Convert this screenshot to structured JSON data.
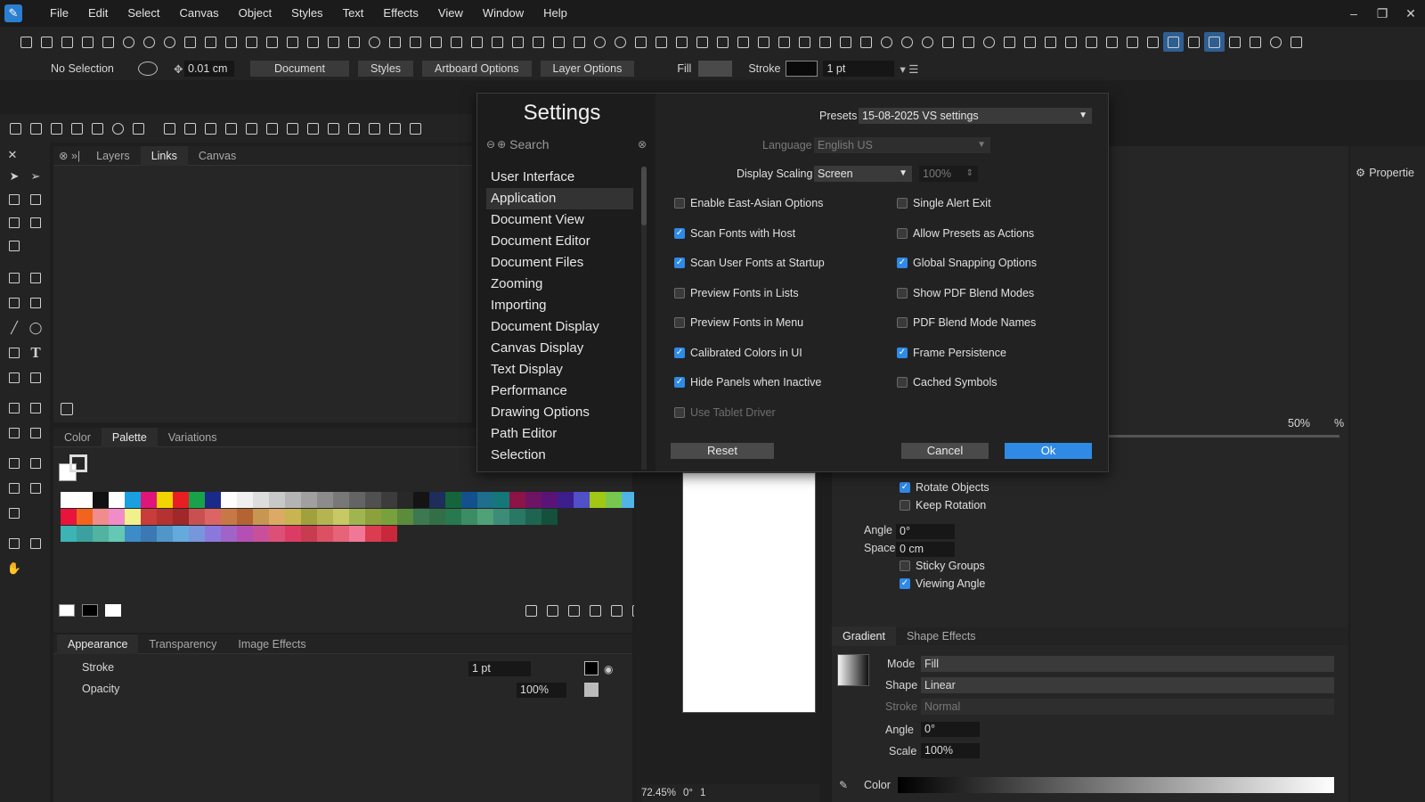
{
  "menubar": {
    "items": [
      "File",
      "Edit",
      "Select",
      "Canvas",
      "Object",
      "Styles",
      "Text",
      "Effects",
      "View",
      "Window",
      "Help"
    ],
    "window_controls": [
      "–",
      "❐",
      "✕"
    ]
  },
  "control_bar": {
    "selection": "No Selection",
    "offset_value": "0.01 cm",
    "buttons": [
      "Document",
      "Styles",
      "Artboard Options",
      "Layer Options"
    ],
    "fill_label": "Fill",
    "stroke_label": "Stroke",
    "stroke_width": "1 pt"
  },
  "links_panel": {
    "tabs": [
      "Layers",
      "Links",
      "Canvas"
    ],
    "active_tab": "Links"
  },
  "palette_panel": {
    "tabs": [
      "Color",
      "Palette",
      "Variations"
    ],
    "active_tab": "Palette"
  },
  "appearance_panel": {
    "tabs": [
      "Appearance",
      "Transparency",
      "Image Effects"
    ],
    "stroke_label": "Stroke",
    "stroke_value": "1 pt",
    "opacity_label": "Opacity",
    "opacity_value": "100%"
  },
  "canvas_status": {
    "zoom": "72.45%",
    "rotation": "0°",
    "page": "1"
  },
  "right_panel": {
    "percent_value": "50%",
    "percent_unit": "%",
    "rotate_objects": "Rotate Objects",
    "keep_rotation": "Keep Rotation",
    "angle_label": "Angle",
    "angle_value": "0°",
    "space_label": "Space",
    "space_value": "0 cm",
    "sticky_groups": "Sticky Groups",
    "viewing_angle": "Viewing Angle",
    "gradient_tabs": [
      "Gradient",
      "Shape Effects"
    ],
    "mode_label": "Mode",
    "mode_value": "Fill",
    "shape_label": "Shape",
    "shape_value": "Linear",
    "stroke_label": "Stroke",
    "stroke_value": "Normal",
    "g_angle_label": "Angle",
    "g_angle_value": "0°",
    "scale_label": "Scale",
    "scale_value": "100%",
    "color_label": "Color"
  },
  "properties_tab": {
    "label": "Propertie"
  },
  "settings": {
    "title": "Settings",
    "search_placeholder": "Search",
    "nav": [
      "User Interface",
      "Application",
      "Document View",
      "Document Editor",
      "Document Files",
      "Zooming",
      "Importing",
      "Document Display",
      "Canvas Display",
      "Text Display",
      "Performance",
      "Drawing Options",
      "Path Editor",
      "Selection"
    ],
    "selected_nav": "Application",
    "presets_label": "Presets",
    "presets_value": "15-08-2025 VS settings",
    "language_label": "Language",
    "language_value": "English US",
    "display_scaling_label": "Display Scaling",
    "display_scaling_value": "Screen",
    "scaling_percent": "100%",
    "options_left": [
      {
        "label": "Enable East-Asian Options",
        "checked": false
      },
      {
        "label": "Scan Fonts with Host",
        "checked": true
      },
      {
        "label": "Scan User Fonts at Startup",
        "checked": true
      },
      {
        "label": "Preview Fonts in Lists",
        "checked": false
      },
      {
        "label": "Preview Fonts in Menu",
        "checked": false
      },
      {
        "label": "Calibrated Colors in UI",
        "checked": true
      },
      {
        "label": "Hide Panels when Inactive",
        "checked": true
      },
      {
        "label": "Use Tablet Driver",
        "checked": false
      }
    ],
    "options_right": [
      {
        "label": "Single Alert Exit",
        "checked": false
      },
      {
        "label": "Allow Presets as Actions",
        "checked": false
      },
      {
        "label": "Global Snapping Options",
        "checked": true
      },
      {
        "label": "Show PDF Blend Modes",
        "checked": false
      },
      {
        "label": "PDF Blend Mode Names",
        "checked": false
      },
      {
        "label": "Frame Persistence",
        "checked": true
      },
      {
        "label": "Cached Symbols",
        "checked": false
      }
    ],
    "reset_label": "Reset",
    "cancel_label": "Cancel",
    "ok_label": "Ok"
  },
  "colors": {
    "accent": "#2f8ae6",
    "dialog_bg": "#222222",
    "panel_bg": "#262626"
  }
}
